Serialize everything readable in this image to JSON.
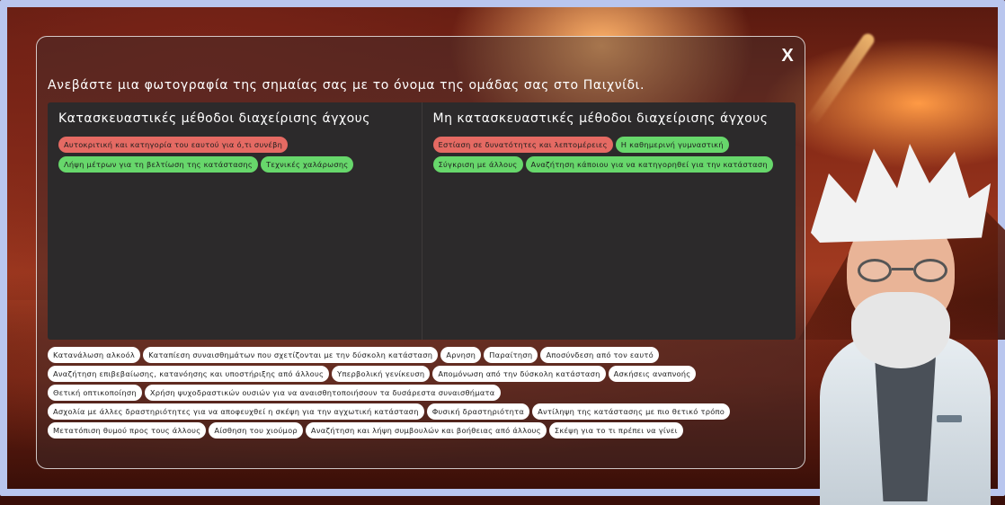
{
  "modal": {
    "close_label": "X",
    "instruction": "Ανεβάστε μια φωτογραφία της σημαίας σας με το όνομα της ομάδας σας στο Παιχνίδι."
  },
  "constructive": {
    "title": "Κατασκευαστικές μέθοδοι διαχείρισης άγχους",
    "chips": [
      {
        "label": "Αυτοκριτική και κατηγορία του εαυτού για ό,τι συνέβη",
        "status": "incorrect"
      },
      {
        "label": "Λήψη μέτρων για τη βελτίωση της κατάστασης",
        "status": "correct"
      },
      {
        "label": "Τεχνικές χαλάρωσης",
        "status": "correct"
      }
    ]
  },
  "nonconstructive": {
    "title": "Μη κατασκευαστικές μέθοδοι διαχείρισης άγχους",
    "chips": [
      {
        "label": "Εστίαση σε δυνατότητες και λεπτομέρειες",
        "status": "incorrect"
      },
      {
        "label": "Η καθημερινή γυμναστική",
        "status": "correct"
      },
      {
        "label": "Σύγκριση με άλλους",
        "status": "correct"
      },
      {
        "label": "Αναζήτηση κάποιου για να κατηγορηθεί για την κατάσταση",
        "status": "correct"
      }
    ]
  },
  "bank": [
    "Κατανάλωση αλκοόλ",
    "Καταπίεση συναισθημάτων που σχετίζονται με την δύσκολη κατάσταση",
    "Αρνηση",
    "Παραίτηση",
    "Αποσύνδεση από τον εαυτό",
    "Αναζήτηση επιβεβαίωσης, κατανόησης και υποστήριξης από άλλους",
    "Υπερβολική γενίκευση",
    "Απομόνωση από την δύσκολη κατάσταση",
    "Ασκήσεις αναπνοής",
    "Θετική οπτικοποίηση",
    "Χρήση ψυχοδραστικών ουσιών για να αναισθητοποιήσουν τα δυσάρεστα συναισθήματα",
    "Ασχολία με άλλες δραστηριότητες για να αποφευχθεί η σκέψη για την αγχωτική κατάσταση",
    "Φυσική δραστηριότητα",
    "Αντίληψη της κατάστασης με πιο θετικό τρόπο",
    "Μετατόπιση θυμού προς τους άλλους",
    "Αίσθηση του χιούμορ",
    "Αναζήτηση και λήψη συμβουλών και βοήθειας από άλλους",
    "Σκέψη για το τι πρέπει να γίνει"
  ],
  "colors": {
    "correct": "#67d76b",
    "incorrect": "#e56a63",
    "unsorted": "#ffffff",
    "frame": "#b9c6ee"
  }
}
